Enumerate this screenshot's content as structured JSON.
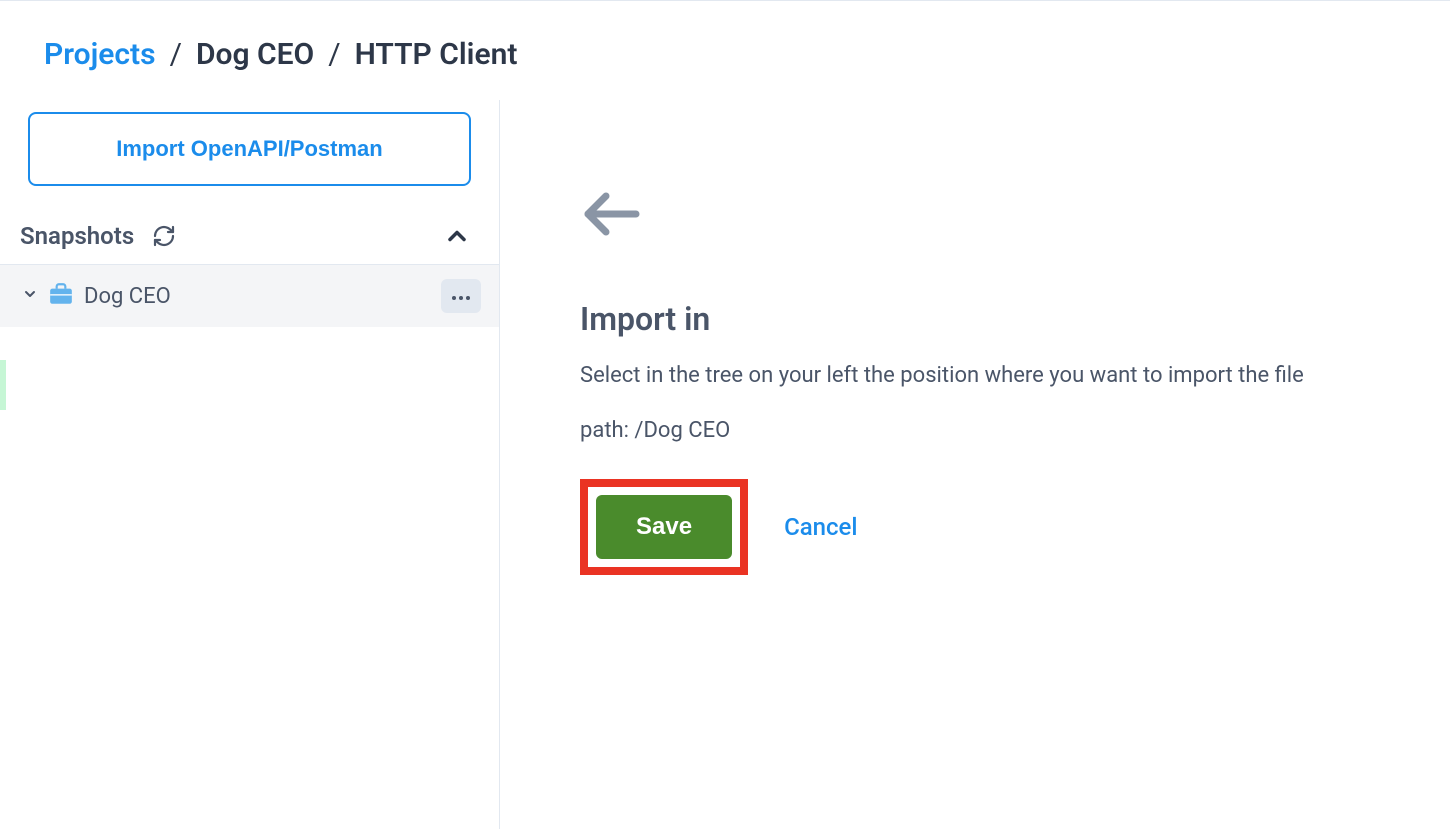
{
  "breadcrumb": {
    "root": "Projects",
    "project": "Dog CEO",
    "page": "HTTP Client"
  },
  "sidebar": {
    "import_button": "Import OpenAPI/Postman",
    "snapshots_label": "Snapshots",
    "tree": {
      "project_name": "Dog CEO"
    }
  },
  "main": {
    "title": "Import in",
    "description": "Select in the tree on your left the position where you want to import the file",
    "path_label": "path: /Dog CEO",
    "save_label": "Save",
    "cancel_label": "Cancel"
  }
}
